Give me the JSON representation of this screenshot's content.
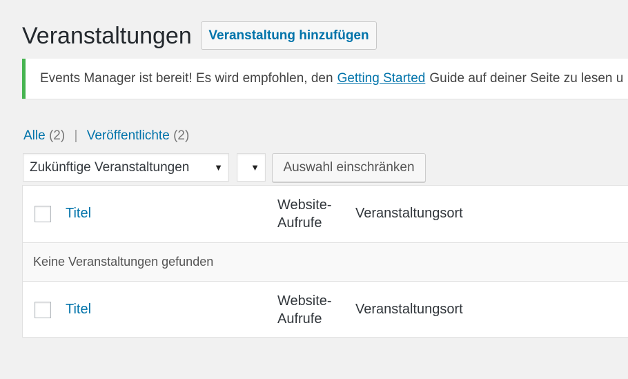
{
  "header": {
    "title": "Veranstaltungen",
    "add_button": "Veranstaltung hinzufügen"
  },
  "notice": {
    "text_before": "Events Manager ist bereit! Es wird empfohlen, den",
    "link": "Getting Started",
    "text_after": "Guide auf deiner Seite zu lesen u",
    "accent_color": "#46b450"
  },
  "views": {
    "all_label": "Alle",
    "all_count": "(2)",
    "separator": "|",
    "published_label": "Veröffentlichte",
    "published_count": "(2)"
  },
  "filters": {
    "scope_selected": "Zukünftige Veranstaltungen",
    "category_selected": "",
    "apply_button": "Auswahl einschränken"
  },
  "table": {
    "columns": {
      "title": "Titel",
      "views_line1": "Website-",
      "views_line2": "Aufrufe",
      "location": "Veranstaltungsort"
    },
    "empty_message": "Keine Veranstaltungen gefunden"
  }
}
